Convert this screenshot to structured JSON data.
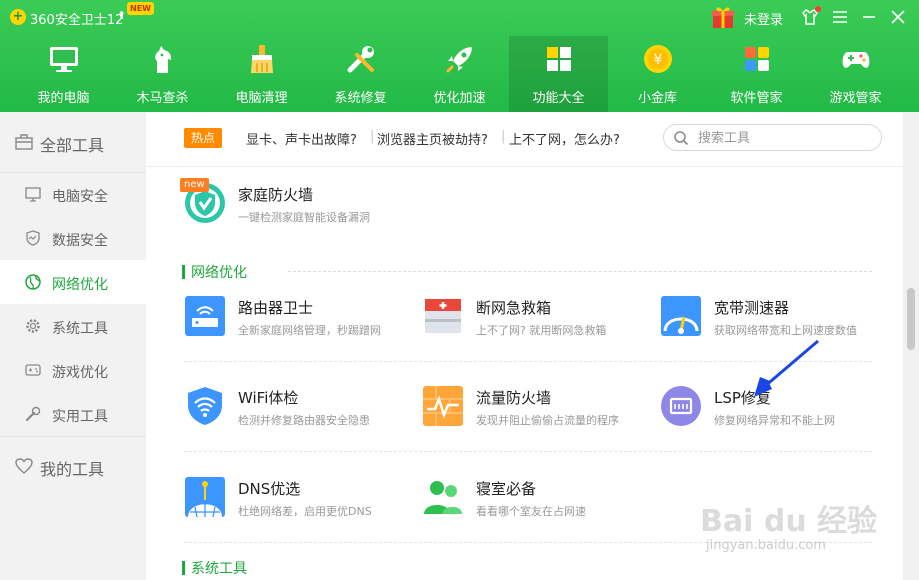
{
  "titlebar": {
    "app_title": "360安全卫士12",
    "new_badge": "NEW",
    "login_text": "未登录"
  },
  "nav": [
    {
      "label": "我的电脑",
      "icon": "monitor-icon"
    },
    {
      "label": "木马查杀",
      "icon": "horse-icon"
    },
    {
      "label": "电脑清理",
      "icon": "broom-icon"
    },
    {
      "label": "系统修复",
      "icon": "wrench-icon"
    },
    {
      "label": "优化加速",
      "icon": "rocket-icon"
    },
    {
      "label": "功能大全",
      "icon": "grid-icon",
      "active": true
    },
    {
      "label": "小金库",
      "icon": "coin-icon"
    },
    {
      "label": "软件管家",
      "icon": "apps-icon"
    },
    {
      "label": "游戏管家",
      "icon": "gamepad-icon"
    }
  ],
  "sidebar": {
    "group_all": "全部工具",
    "items": [
      {
        "label": "电脑安全",
        "icon": "monitor-icon"
      },
      {
        "label": "数据安全",
        "icon": "shield-icon"
      },
      {
        "label": "网络优化",
        "icon": "globe-icon",
        "active": true
      },
      {
        "label": "系统工具",
        "icon": "gear-icon"
      },
      {
        "label": "游戏优化",
        "icon": "gamepad-icon"
      },
      {
        "label": "实用工具",
        "icon": "wrench-icon"
      }
    ],
    "group_mine": "我的工具"
  },
  "hotbar": {
    "tag": "热点",
    "links": [
      "显卡、声卡出故障?",
      "浏览器主页被劫持?",
      "上不了网，怎么办?"
    ],
    "search_placeholder": "搜索工具"
  },
  "tools_top": [
    {
      "name": "家庭防火墙",
      "desc": "一键检测家庭智能设备漏洞",
      "badge": "new"
    }
  ],
  "sections": {
    "network": "网络优化",
    "system": "系统工具"
  },
  "tools_network": [
    {
      "name": "路由器卫士",
      "desc": "全新家庭网络管理，秒踢蹭网"
    },
    {
      "name": "断网急救箱",
      "desc": "上不了网? 就用断网急救箱"
    },
    {
      "name": "宽带测速器",
      "desc": "获取网络带宽和上网速度数值"
    },
    {
      "name": "WiFi体检",
      "desc": "检测并修复路由器安全隐患"
    },
    {
      "name": "流量防火墙",
      "desc": "发现并阻止偷偷占流量的程序"
    },
    {
      "name": "LSP修复",
      "desc": "修复网络异常和不能上网"
    },
    {
      "name": "DNS优选",
      "desc": "杜绝网络差，启用更优DNS"
    },
    {
      "name": "寝室必备",
      "desc": "看看哪个室友在占网速"
    }
  ],
  "watermark": {
    "main": "Bai du 经验",
    "sub": "jingyan.baidu.com"
  },
  "colors": {
    "header_green": "#22b946",
    "accent_green": "#1ea83c",
    "hot_orange": "#ff8a00",
    "annotation_blue": "#1a46e6"
  }
}
